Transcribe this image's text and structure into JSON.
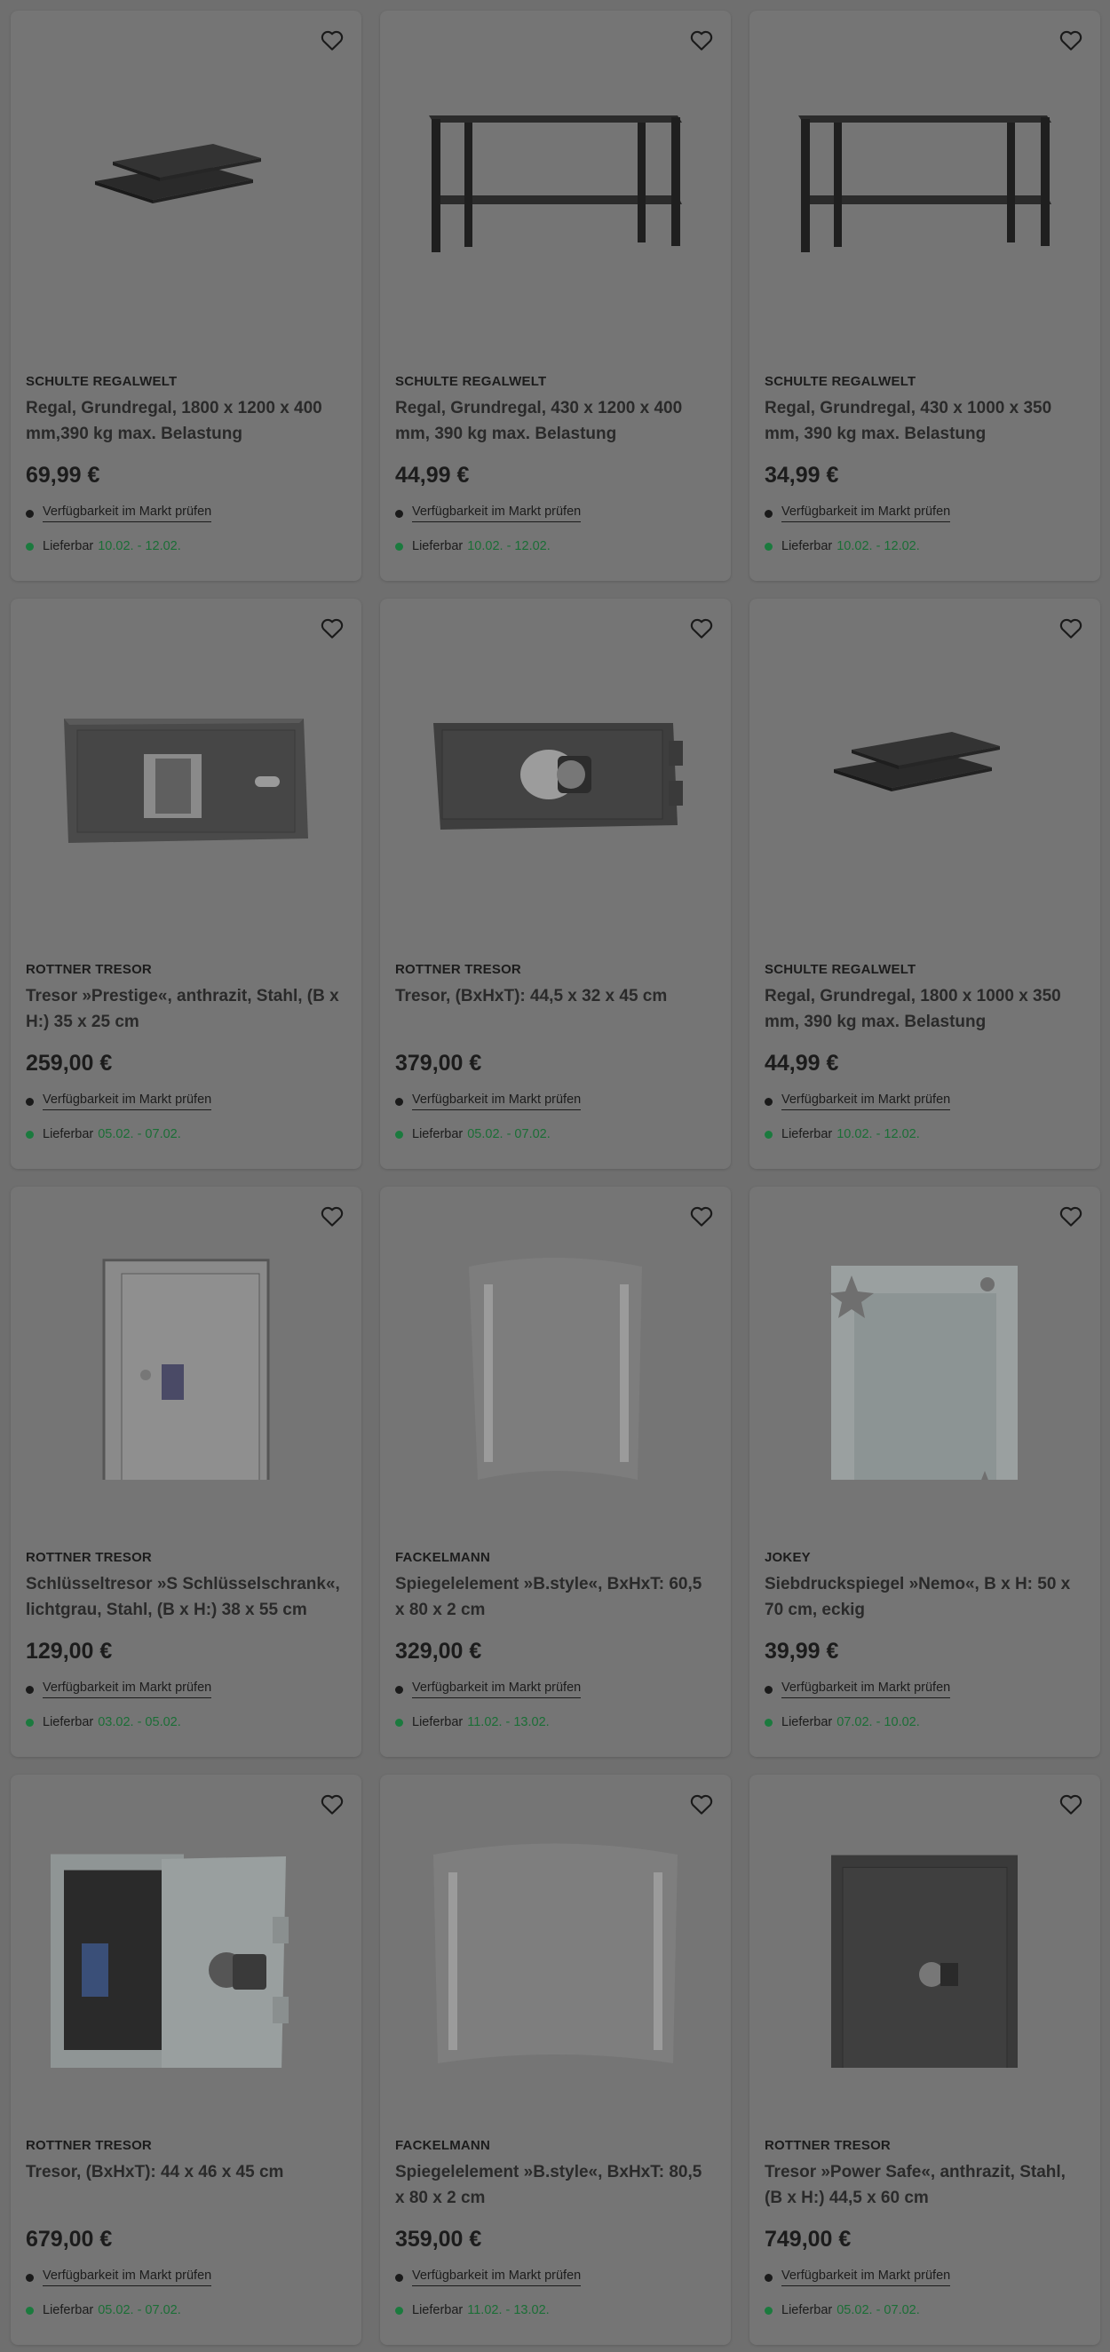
{
  "colors": {
    "delivery_accent": "#1b7a3e",
    "background_overlay": "#6f6f6f"
  },
  "products": [
    {
      "brand": "SCHULTE REGALWELT",
      "title": "Regal, Grundregal, 1800 x 1200 x 400 mm,390 kg max. Belastung",
      "price": "69,99 €",
      "availability": "Verfügbarkeit im Markt prüfen",
      "delivery_label": "Lieferbar",
      "delivery_dates": "10.02. - 12.02.",
      "image": "shelf-boards",
      "favorite_icon": "heart-icon"
    },
    {
      "brand": "SCHULTE REGALWELT",
      "title": "Regal, Grundregal, 430 x 1200 x 400 mm, 390 kg max. Belastung",
      "price": "44,99 €",
      "availability": "Verfügbarkeit im Markt prüfen",
      "delivery_label": "Lieferbar",
      "delivery_dates": "10.02. - 12.02.",
      "image": "shelf-frame",
      "favorite_icon": "heart-icon"
    },
    {
      "brand": "SCHULTE REGALWELT",
      "title": "Regal, Grundregal, 430 x 1000 x 350 mm, 390 kg max. Belastung",
      "price": "34,99 €",
      "availability": "Verfügbarkeit im Markt prüfen",
      "delivery_label": "Lieferbar",
      "delivery_dates": "10.02. - 12.02.",
      "image": "shelf-frame",
      "favorite_icon": "heart-icon"
    },
    {
      "brand": "ROTTNER TRESOR",
      "title": "Tresor »Prestige«, anthrazit, Stahl, (B x H:) 35 x 25 cm",
      "price": "259,00 €",
      "availability": "Verfügbarkeit im Markt prüfen",
      "delivery_label": "Lieferbar",
      "delivery_dates": "05.02. - 07.02.",
      "image": "safe-wide",
      "favorite_icon": "heart-icon"
    },
    {
      "brand": "ROTTNER TRESOR",
      "title": "Tresor, (BxHxT): 44,5 x 32 x 45 cm",
      "price": "379,00 €",
      "availability": "Verfügbarkeit im Markt prüfen",
      "delivery_label": "Lieferbar",
      "delivery_dates": "05.02. - 07.02.",
      "image": "safe-dial",
      "favorite_icon": "heart-icon"
    },
    {
      "brand": "SCHULTE REGALWELT",
      "title": "Regal, Grundregal, 1800 x 1000 x 350 mm, 390 kg max. Belastung",
      "price": "44,99 €",
      "availability": "Verfügbarkeit im Markt prüfen",
      "delivery_label": "Lieferbar",
      "delivery_dates": "10.02. - 12.02.",
      "image": "shelf-boards",
      "favorite_icon": "heart-icon"
    },
    {
      "brand": "ROTTNER TRESOR",
      "title": "Schlüsseltresor »S Schlüsselschrank«, lichtgrau, Stahl, (B x H:) 38 x 55 cm",
      "price": "129,00 €",
      "availability": "Verfügbarkeit im Markt prüfen",
      "delivery_label": "Lieferbar",
      "delivery_dates": "03.02. - 05.02.",
      "image": "key-cabinet",
      "favorite_icon": "heart-icon"
    },
    {
      "brand": "FACKELMANN",
      "title": "Spiegelelement »B.style«, BxHxT: 60,5 x 80 x 2 cm",
      "price": "329,00 €",
      "availability": "Verfügbarkeit im Markt prüfen",
      "delivery_label": "Lieferbar",
      "delivery_dates": "11.02. - 13.02.",
      "image": "mirror-tall",
      "favorite_icon": "heart-icon"
    },
    {
      "brand": "JOKEY",
      "title": "Siebdruckspiegel »Nemo«, B x H: 50 x 70 cm, eckig",
      "price": "39,99 €",
      "availability": "Verfügbarkeit im Markt prüfen",
      "delivery_label": "Lieferbar",
      "delivery_dates": "07.02. - 10.02.",
      "image": "mirror-decor",
      "favorite_icon": "heart-icon"
    },
    {
      "brand": "ROTTNER TRESOR",
      "title": "Tresor, (BxHxT): 44 x 46 x 45 cm",
      "price": "679,00 €",
      "availability": "Verfügbarkeit im Markt prüfen",
      "delivery_label": "Lieferbar",
      "delivery_dates": "05.02. - 07.02.",
      "image": "safe-open",
      "favorite_icon": "heart-icon"
    },
    {
      "brand": "FACKELMANN",
      "title": "Spiegelelement »B.style«, BxHxT: 80,5 x 80 x 2 cm",
      "price": "359,00 €",
      "availability": "Verfügbarkeit im Markt prüfen",
      "delivery_label": "Lieferbar",
      "delivery_dates": "11.02. - 13.02.",
      "image": "mirror-wide",
      "favorite_icon": "heart-icon"
    },
    {
      "brand": "ROTTNER TRESOR",
      "title": "Tresor »Power Safe«, anthrazit, Stahl, (B x H:) 44,5 x 60 cm",
      "price": "749,00 €",
      "availability": "Verfügbarkeit im Markt prüfen",
      "delivery_label": "Lieferbar",
      "delivery_dates": "05.02. - 07.02.",
      "image": "safe-tall",
      "favorite_icon": "heart-icon"
    }
  ]
}
